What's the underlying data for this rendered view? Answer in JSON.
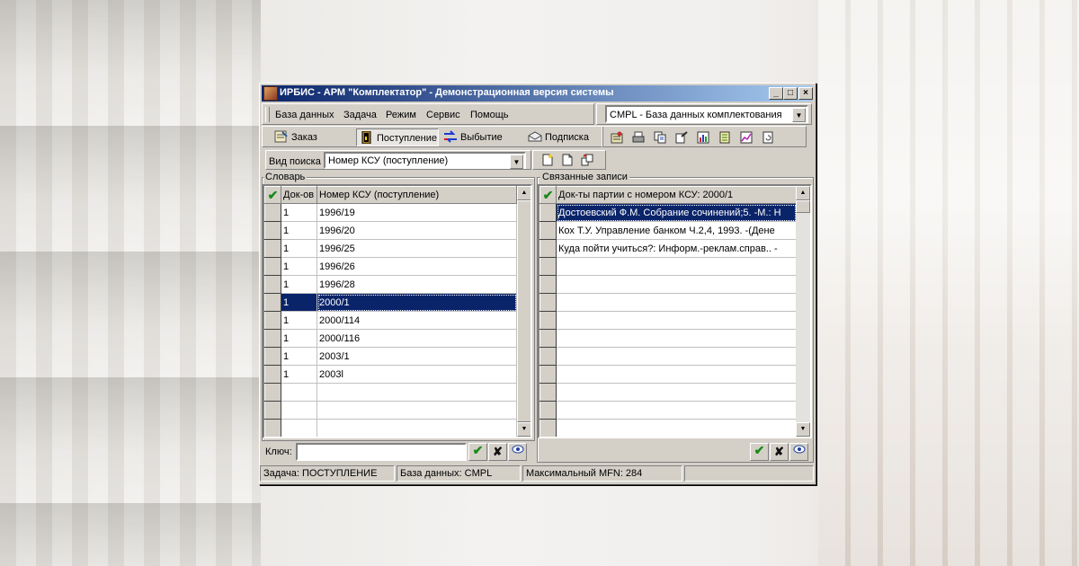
{
  "window": {
    "title": "ИРБИС - АРМ \"Комплектатор\" - Демонстрационная версия системы",
    "controls": [
      "_",
      "□",
      "×"
    ]
  },
  "menu": [
    "База данных",
    "Задача",
    "Режим",
    "Сервис",
    "Помощь"
  ],
  "database_select": {
    "value": "CMPL - База данных комплектования"
  },
  "tabs": [
    {
      "label": "Заказ",
      "icon": "order-icon"
    },
    {
      "label": "Поступление",
      "icon": "receipt-icon",
      "active": true
    },
    {
      "label": "Выбытие",
      "icon": "disposal-icon"
    },
    {
      "label": "Подписка",
      "icon": "subscription-icon"
    }
  ],
  "toolbar_icons": [
    "stamp-icon",
    "printer-icon",
    "copy-records-icon",
    "export-icon",
    "chart-icon",
    "notebook-icon",
    "graph-icon",
    "refresh-icon"
  ],
  "search": {
    "label": "Вид поиска",
    "value": "Номер КСУ (поступление)"
  },
  "search_buttons": [
    "new-document-icon",
    "blank-document-icon",
    "transfer-icon"
  ],
  "dictionary": {
    "title": "Словарь",
    "columns": [
      "Док-ов",
      "Номер КСУ (поступление)"
    ],
    "rows": [
      {
        "count": "1",
        "value": "1996/19"
      },
      {
        "count": "1",
        "value": "1996/20"
      },
      {
        "count": "1",
        "value": "1996/25"
      },
      {
        "count": "1",
        "value": "1996/26"
      },
      {
        "count": "1",
        "value": "1996/28"
      },
      {
        "count": "1",
        "value": "2000/1",
        "selected": true
      },
      {
        "count": "1",
        "value": "2000/114"
      },
      {
        "count": "1",
        "value": "2000/116"
      },
      {
        "count": "1",
        "value": "2003/1"
      },
      {
        "count": "1",
        "value": "2003l"
      },
      {
        "count": "",
        "value": ""
      },
      {
        "count": "",
        "value": ""
      },
      {
        "count": "",
        "value": ""
      }
    ],
    "key_label": "Ключ:",
    "key_value": ""
  },
  "linked": {
    "title": "Связанные записи",
    "header": "Док-ты партии с номером КСУ: 2000/1",
    "rows": [
      {
        "text": "Достоевский Ф.М. Собрание сочинений;5. -М.: Н",
        "selected": true
      },
      {
        "text": "Кох Т.У. Управление банком Ч.2,4, 1993. -(Дене"
      },
      {
        "text": "Куда пойти учиться?: Информ.-реклам.справ.. -"
      },
      {
        "text": ""
      },
      {
        "text": ""
      },
      {
        "text": ""
      },
      {
        "text": ""
      },
      {
        "text": ""
      },
      {
        "text": ""
      },
      {
        "text": ""
      },
      {
        "text": ""
      },
      {
        "text": ""
      },
      {
        "text": ""
      }
    ]
  },
  "status": {
    "task": "Задача:  ПОСТУПЛЕНИЕ",
    "db": "База данных: CMPL",
    "mfn": "Максимальный MFN: 284",
    "extra": ""
  },
  "colors": {
    "title_start": "#0a246a",
    "title_end": "#a6caf0",
    "selection": "#0a246a",
    "face": "#d4d0c8"
  }
}
